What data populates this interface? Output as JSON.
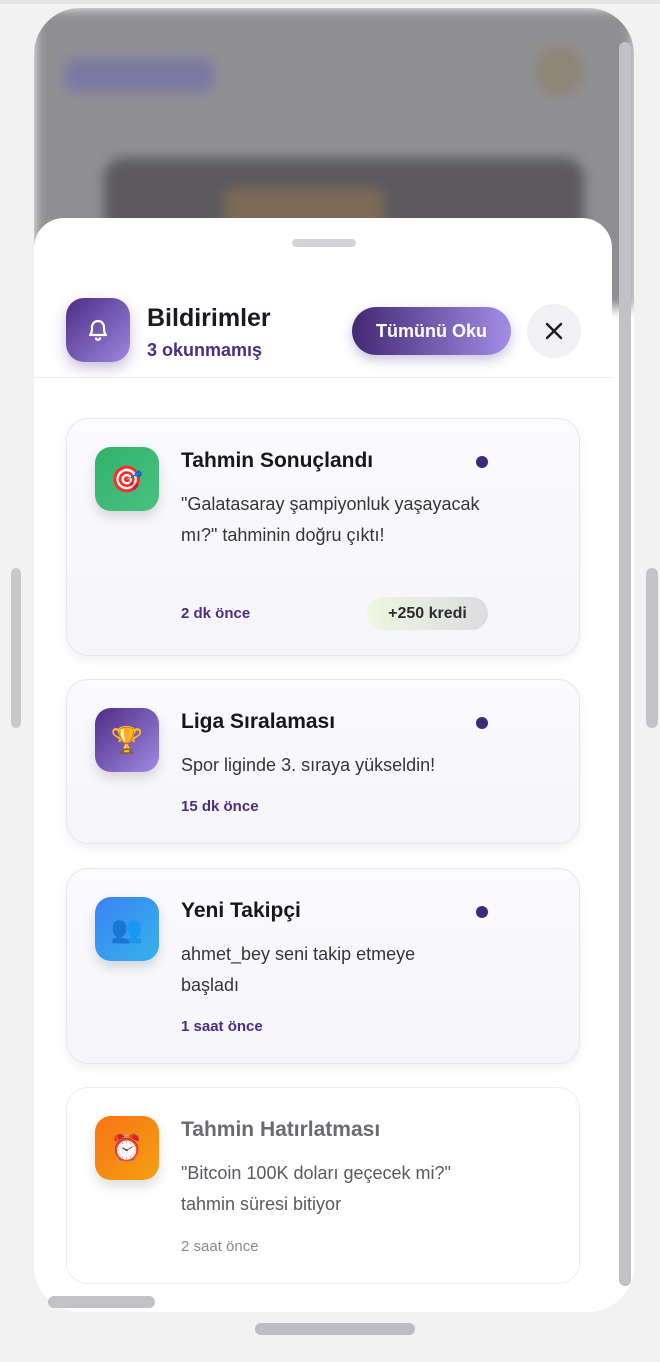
{
  "header": {
    "title": "Bildirimler",
    "unread_count": "3 okunmamış",
    "read_all_label": "Tümünü Oku",
    "close_label": "✕",
    "bell_icon": "bell-icon"
  },
  "notifications": [
    {
      "icon": "🎯",
      "icon_name": "target-icon",
      "title": "Tahmin Sonuçlandı",
      "message": "\"Galatasaray şampiyonluk yaşayacak mı?\" tahminin doğru çıktı!",
      "time": "2 dk önce",
      "reward": "+250 kredi",
      "unread": true
    },
    {
      "icon": "🏆",
      "icon_name": "trophy-icon",
      "title": "Liga Sıralaması",
      "message": "Spor liginde 3. sıraya yükseldin!",
      "time": "15 dk önce",
      "unread": true
    },
    {
      "icon": "👥",
      "icon_name": "users-icon",
      "title": "Yeni Takipçi",
      "message": "ahmet_bey seni takip etmeye başladı",
      "time": "1 saat önce",
      "unread": true
    },
    {
      "icon": "⏰",
      "icon_name": "alarm-clock-icon",
      "title": "Tahmin Hatırlatması",
      "message": "\"Bitcoin 100K doları geçecek mi?\" tahmin süresi bitiyor",
      "time": "2 saat önce",
      "unread": false
    }
  ],
  "colors": {
    "accent": "#4c2d85",
    "unread_dot": "#3e2a78"
  }
}
